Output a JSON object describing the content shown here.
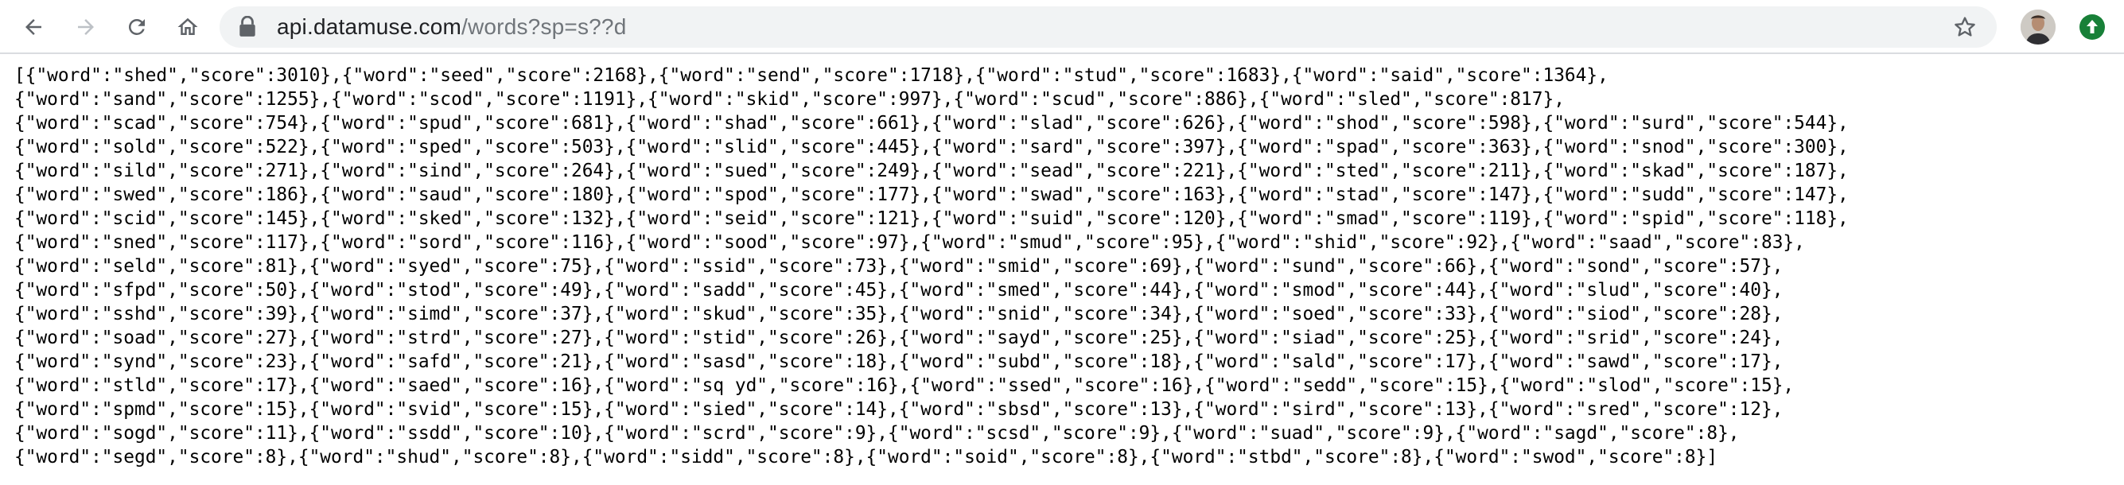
{
  "browser": {
    "url_host": "api.datamuse.com",
    "url_path": "/words?sp=s??d",
    "icons": {
      "back": "arrow-left-icon",
      "forward": "arrow-right-icon",
      "reload": "reload-icon",
      "home": "home-icon",
      "lock": "lock-icon",
      "bookmark": "star-icon",
      "update": "update-arrow-icon"
    },
    "colors": {
      "update_badge": "#188038",
      "omnibox_bg": "#f1f3f4"
    }
  },
  "response_lines": [
    "[{\"word\":\"shed\",\"score\":3010},{\"word\":\"seed\",\"score\":2168},{\"word\":\"send\",\"score\":1718},{\"word\":\"stud\",\"score\":1683},{\"word\":\"said\",\"score\":1364},",
    "{\"word\":\"sand\",\"score\":1255},{\"word\":\"scod\",\"score\":1191},{\"word\":\"skid\",\"score\":997},{\"word\":\"scud\",\"score\":886},{\"word\":\"sled\",\"score\":817},",
    "{\"word\":\"scad\",\"score\":754},{\"word\":\"spud\",\"score\":681},{\"word\":\"shad\",\"score\":661},{\"word\":\"slad\",\"score\":626},{\"word\":\"shod\",\"score\":598},{\"word\":\"surd\",\"score\":544},",
    "{\"word\":\"sold\",\"score\":522},{\"word\":\"sped\",\"score\":503},{\"word\":\"slid\",\"score\":445},{\"word\":\"sard\",\"score\":397},{\"word\":\"spad\",\"score\":363},{\"word\":\"snod\",\"score\":300},",
    "{\"word\":\"sild\",\"score\":271},{\"word\":\"sind\",\"score\":264},{\"word\":\"sued\",\"score\":249},{\"word\":\"sead\",\"score\":221},{\"word\":\"sted\",\"score\":211},{\"word\":\"skad\",\"score\":187},",
    "{\"word\":\"swed\",\"score\":186},{\"word\":\"saud\",\"score\":180},{\"word\":\"spod\",\"score\":177},{\"word\":\"swad\",\"score\":163},{\"word\":\"stad\",\"score\":147},{\"word\":\"sudd\",\"score\":147},",
    "{\"word\":\"scid\",\"score\":145},{\"word\":\"sked\",\"score\":132},{\"word\":\"seid\",\"score\":121},{\"word\":\"suid\",\"score\":120},{\"word\":\"smad\",\"score\":119},{\"word\":\"spid\",\"score\":118},",
    "{\"word\":\"sned\",\"score\":117},{\"word\":\"sord\",\"score\":116},{\"word\":\"sood\",\"score\":97},{\"word\":\"smud\",\"score\":95},{\"word\":\"shid\",\"score\":92},{\"word\":\"saad\",\"score\":83},",
    "{\"word\":\"seld\",\"score\":81},{\"word\":\"syed\",\"score\":75},{\"word\":\"ssid\",\"score\":73},{\"word\":\"smid\",\"score\":69},{\"word\":\"sund\",\"score\":66},{\"word\":\"sond\",\"score\":57},",
    "{\"word\":\"sfpd\",\"score\":50},{\"word\":\"stod\",\"score\":49},{\"word\":\"sadd\",\"score\":45},{\"word\":\"smed\",\"score\":44},{\"word\":\"smod\",\"score\":44},{\"word\":\"slud\",\"score\":40},",
    "{\"word\":\"sshd\",\"score\":39},{\"word\":\"simd\",\"score\":37},{\"word\":\"skud\",\"score\":35},{\"word\":\"snid\",\"score\":34},{\"word\":\"soed\",\"score\":33},{\"word\":\"siod\",\"score\":28},",
    "{\"word\":\"soad\",\"score\":27},{\"word\":\"strd\",\"score\":27},{\"word\":\"stid\",\"score\":26},{\"word\":\"sayd\",\"score\":25},{\"word\":\"siad\",\"score\":25},{\"word\":\"srid\",\"score\":24},",
    "{\"word\":\"synd\",\"score\":23},{\"word\":\"safd\",\"score\":21},{\"word\":\"sasd\",\"score\":18},{\"word\":\"subd\",\"score\":18},{\"word\":\"sald\",\"score\":17},{\"word\":\"sawd\",\"score\":17},",
    "{\"word\":\"stld\",\"score\":17},{\"word\":\"saed\",\"score\":16},{\"word\":\"sq yd\",\"score\":16},{\"word\":\"ssed\",\"score\":16},{\"word\":\"sedd\",\"score\":15},{\"word\":\"slod\",\"score\":15},",
    "{\"word\":\"spmd\",\"score\":15},{\"word\":\"svid\",\"score\":15},{\"word\":\"sied\",\"score\":14},{\"word\":\"sbsd\",\"score\":13},{\"word\":\"sird\",\"score\":13},{\"word\":\"sred\",\"score\":12},",
    "{\"word\":\"sogd\",\"score\":11},{\"word\":\"ssdd\",\"score\":10},{\"word\":\"scrd\",\"score\":9},{\"word\":\"scsd\",\"score\":9},{\"word\":\"suad\",\"score\":9},{\"word\":\"sagd\",\"score\":8},",
    "{\"word\":\"segd\",\"score\":8},{\"word\":\"shud\",\"score\":8},{\"word\":\"sidd\",\"score\":8},{\"word\":\"soid\",\"score\":8},{\"word\":\"stbd\",\"score\":8},{\"word\":\"swod\",\"score\":8}]"
  ]
}
